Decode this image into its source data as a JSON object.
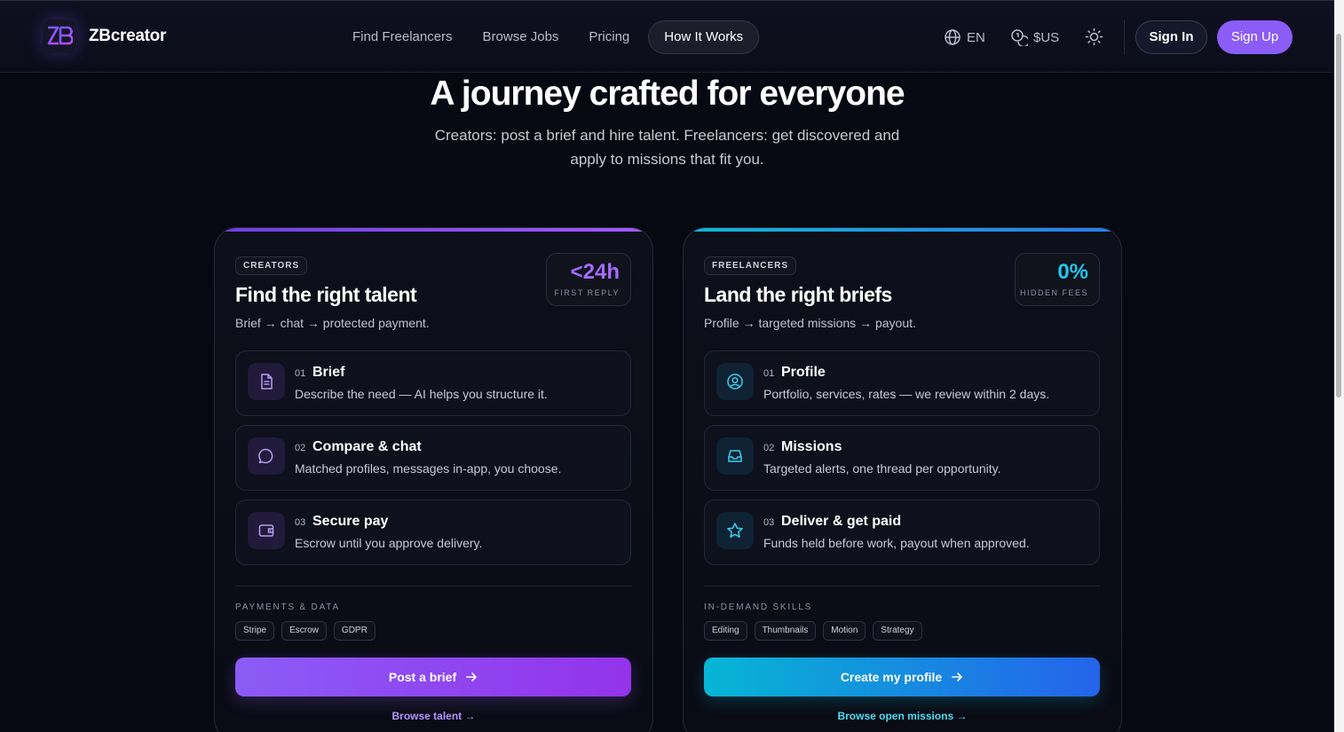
{
  "brand": {
    "name": "ZBcreator",
    "logo_glyph": "ZB",
    "accent": "#8b5cf6",
    "cyan": "#06b6d4"
  },
  "nav": {
    "items": [
      {
        "label": "Find Freelancers"
      },
      {
        "label": "Browse Jobs"
      },
      {
        "label": "Pricing"
      },
      {
        "label": "How It Works",
        "active": true
      }
    ]
  },
  "header_tools": {
    "language": "EN",
    "currency": "$US",
    "theme_icon": "sun-icon",
    "sign_in": "Sign In",
    "sign_up": "Sign Up"
  },
  "hero": {
    "title": "A journey crafted for everyone",
    "subtitle": "Creators: post a brief and hire talent. Freelancers: get discovered and apply to missions that fit you."
  },
  "cards": {
    "creators": {
      "badge": "CREATORS",
      "stat_value": "<24h",
      "stat_label": "FIRST REPLY",
      "title": "Find the right talent",
      "subtitle": "Brief → chat → protected payment.",
      "steps": [
        {
          "num": "01",
          "title": "Brief",
          "desc": "Describe the need — AI helps you structure it.",
          "icon": "document-icon"
        },
        {
          "num": "02",
          "title": "Compare & chat",
          "desc": "Matched profiles, messages in-app, you choose.",
          "icon": "chat-bubble-icon"
        },
        {
          "num": "03",
          "title": "Secure pay",
          "desc": "Escrow until you approve delivery.",
          "icon": "wallet-icon"
        }
      ],
      "section_label": "PAYMENTS & DATA",
      "tags": [
        "Stripe",
        "Escrow",
        "GDPR"
      ],
      "cta": "Post a brief",
      "link": "Browse talent"
    },
    "freelancers": {
      "badge": "FREELANCERS",
      "stat_value": "0%",
      "stat_label": "HIDDEN FEES",
      "title": "Land the right briefs",
      "subtitle": "Profile → targeted missions → payout.",
      "steps": [
        {
          "num": "01",
          "title": "Profile",
          "desc": "Portfolio, services, rates — we review within 2 days.",
          "icon": "user-circle-icon"
        },
        {
          "num": "02",
          "title": "Missions",
          "desc": "Targeted alerts, one thread per opportunity.",
          "icon": "inbox-icon"
        },
        {
          "num": "03",
          "title": "Deliver & get paid",
          "desc": "Funds held before work, payout when approved.",
          "icon": "star-icon"
        }
      ],
      "section_label": "IN-DEMAND SKILLS",
      "tags": [
        "Editing",
        "Thumbnails",
        "Motion",
        "Strategy"
      ],
      "cta": "Create my profile",
      "link": "Browse open missions"
    }
  }
}
